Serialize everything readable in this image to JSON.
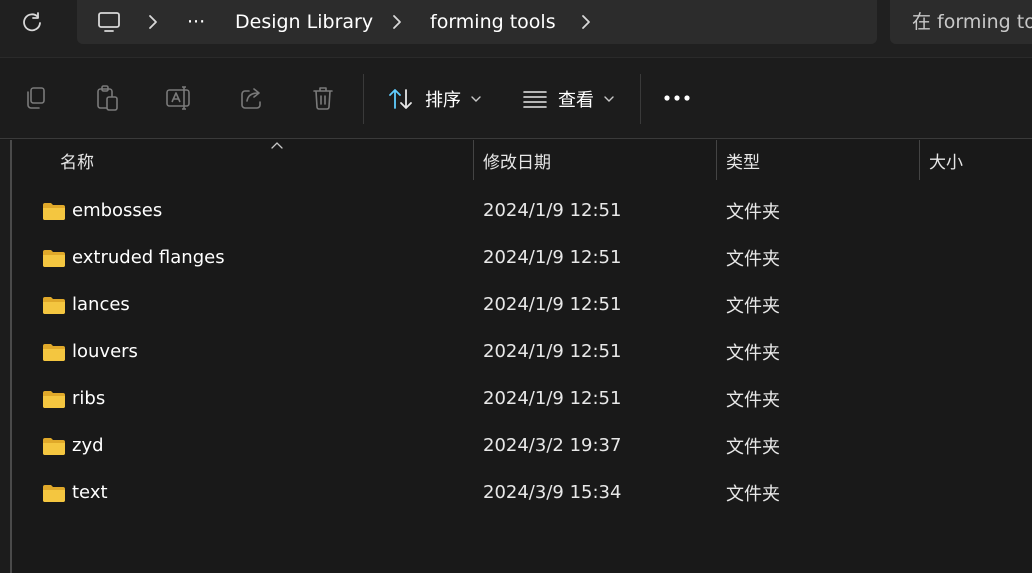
{
  "address_bar": {
    "crumbs": [
      "Design Library",
      "forming tools"
    ],
    "overflow": "···"
  },
  "search": {
    "placeholder": "在 forming tools 中搜索"
  },
  "toolbar": {
    "sort_label": "排序",
    "view_label": "查看"
  },
  "columns": {
    "name": "名称",
    "date": "修改日期",
    "type": "类型",
    "size": "大小"
  },
  "files": [
    {
      "name": "embosses",
      "date": "2024/1/9 12:51",
      "type": "文件夹"
    },
    {
      "name": "extruded flanges",
      "date": "2024/1/9 12:51",
      "type": "文件夹"
    },
    {
      "name": "lances",
      "date": "2024/1/9 12:51",
      "type": "文件夹"
    },
    {
      "name": "louvers",
      "date": "2024/1/9 12:51",
      "type": "文件夹"
    },
    {
      "name": "ribs",
      "date": "2024/1/9 12:51",
      "type": "文件夹"
    },
    {
      "name": "zyd",
      "date": "2024/3/2 19:37",
      "type": "文件夹"
    },
    {
      "name": "text",
      "date": "2024/3/9 15:34",
      "type": "文件夹"
    }
  ],
  "colors": {
    "background": "#191919",
    "folder": "#f4c640",
    "accent": "#60cdff"
  },
  "icons": [
    "refresh-icon",
    "this-pc-icon",
    "chevron-right-icon",
    "copy-icon",
    "paste-icon",
    "rename-icon",
    "share-icon",
    "delete-icon",
    "sort-icon",
    "view-icon",
    "more-icon",
    "folder-icon"
  ]
}
